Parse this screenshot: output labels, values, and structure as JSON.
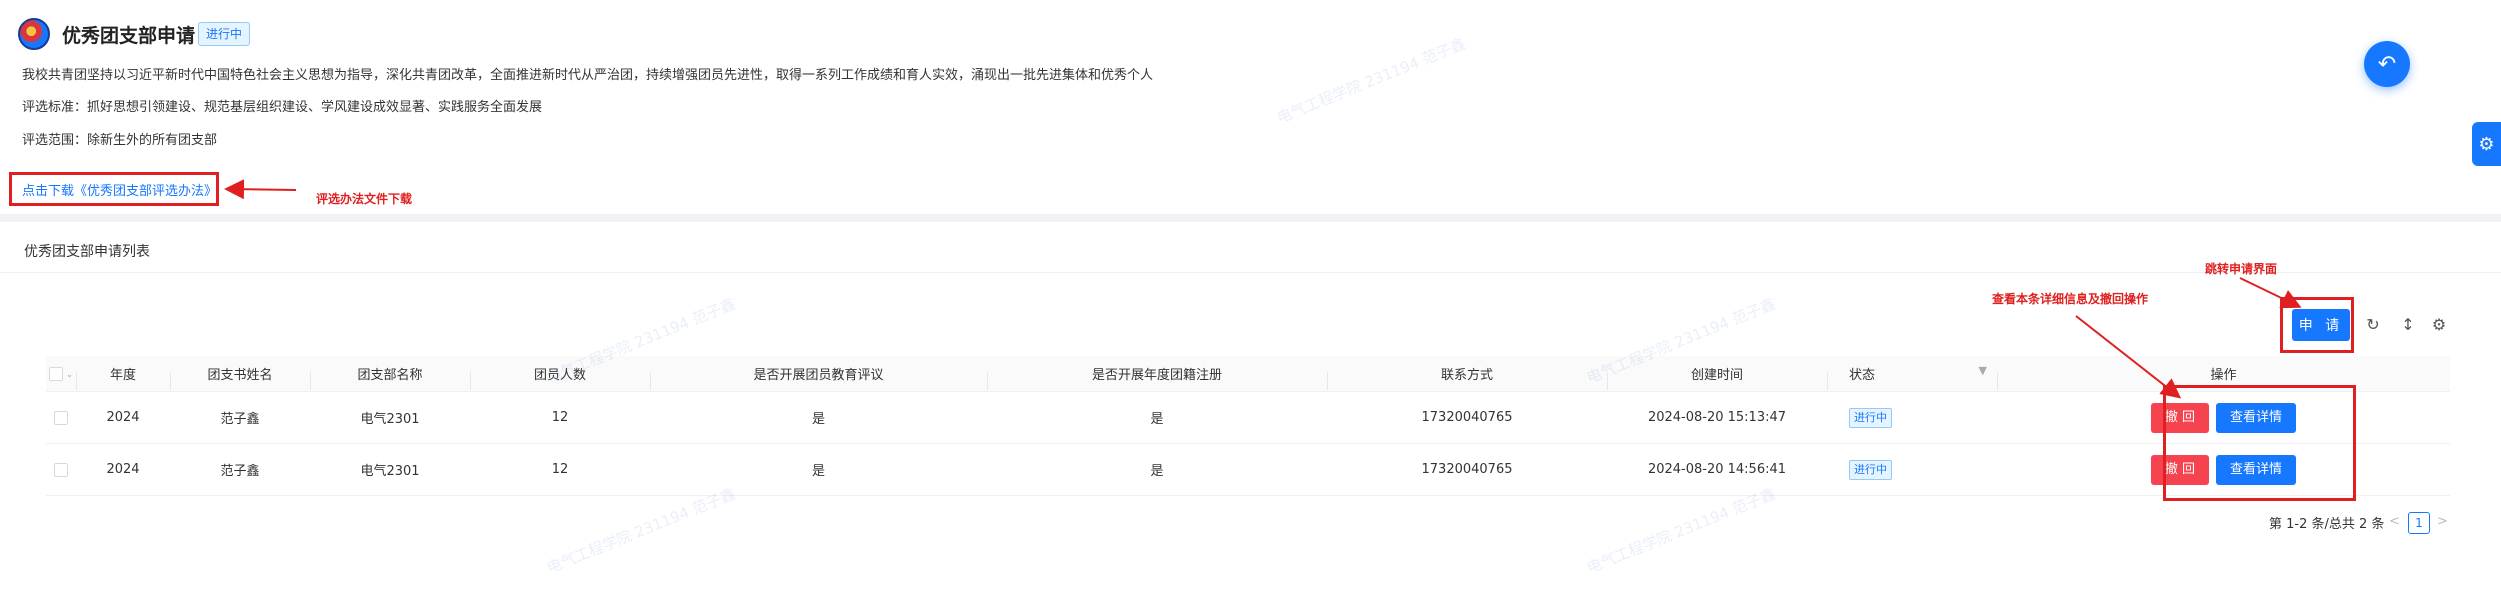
{
  "header": {
    "title": "优秀团支部申请",
    "status": "进行中",
    "description": "我校共青团坚持以习近平新时代中国特色社会主义思想为指导，深化共青团改革，全面推进新时代从严治团，持续增强团员先进性，取得一系列工作成绩和育人实效，涌现出一批先进集体和优秀个人",
    "criteria": "评选标准：抓好思想引领建设、规范基层组织建设、学风建设成效显著、实践服务全面发展",
    "scope": "评选范围：除新生外的所有团支部",
    "download_link": "点击下载《优秀团支部评选办法》"
  },
  "annotations": {
    "download_note": "评选办法文件下载",
    "apply_note": "跳转申请界面",
    "ops_note": "查看本条详细信息及撤回操作"
  },
  "list": {
    "title": "优秀团支部申请列表",
    "apply_button": "申 请",
    "columns": [
      "年度",
      "团支书姓名",
      "团支部名称",
      "团员人数",
      "是否开展团员教育评议",
      "是否开展年度团籍注册",
      "联系方式",
      "创建时间",
      "状态",
      "操作"
    ],
    "rows": [
      {
        "year": "2024",
        "secretary": "范子鑫",
        "branch": "电气2301",
        "members": "12",
        "education_review": "是",
        "annual_registration": "是",
        "phone": "17320040765",
        "created": "2024-08-20 15:13:47",
        "status": "进行中",
        "withdraw": "撤 回",
        "details": "查看详情"
      },
      {
        "year": "2024",
        "secretary": "范子鑫",
        "branch": "电气2301",
        "members": "12",
        "education_review": "是",
        "annual_registration": "是",
        "phone": "17320040765",
        "created": "2024-08-20 14:56:41",
        "status": "进行中",
        "withdraw": "撤 回",
        "details": "查看详情"
      }
    ],
    "pagination": {
      "total_text": "第 1-2 条/总共 2 条",
      "current_page": "1",
      "prev": "<",
      "next": ">"
    }
  },
  "watermark": "电气工程学院 231194 范子鑫",
  "icons": {
    "back": "return-icon",
    "settings_tab": "gear-icon",
    "reload": "reload-icon",
    "density": "column-height-icon",
    "settings": "setting-icon"
  },
  "colors": {
    "primary": "#1677ff",
    "danger": "#f5434f",
    "annotation": "#e02020"
  }
}
